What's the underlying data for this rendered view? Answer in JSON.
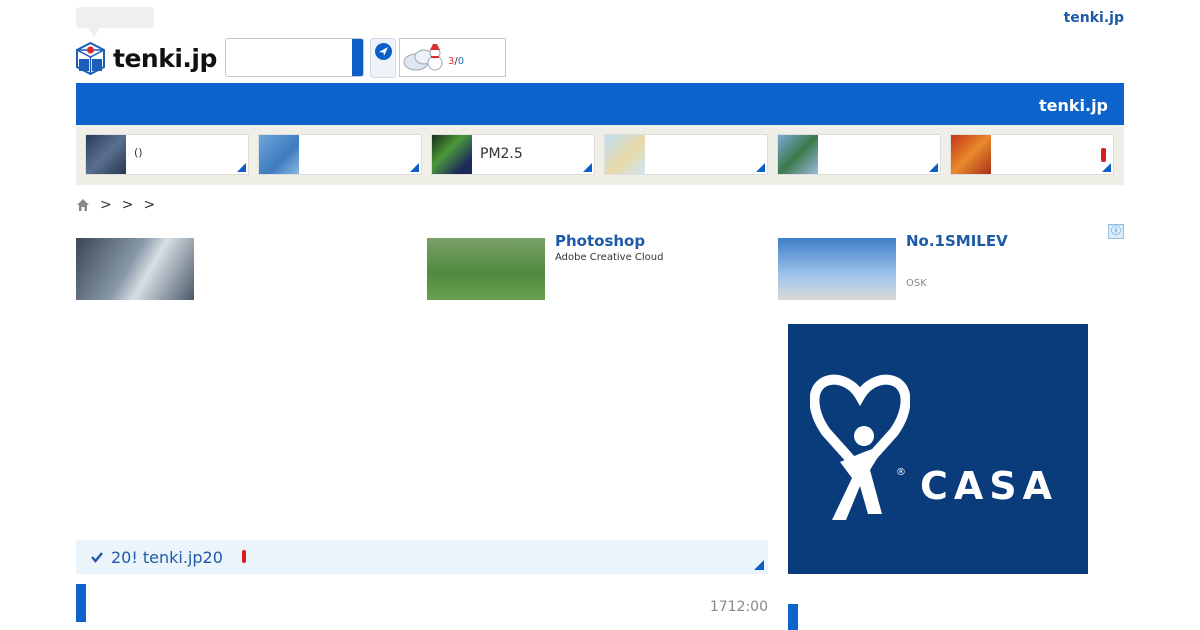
{
  "header": {
    "top_link": "tenki.jp",
    "logo_text": "tenki.jp",
    "search": {
      "placeholder": ""
    },
    "weather_widget": {
      "temp_high": "3",
      "separator": "/",
      "temp_low": "0"
    }
  },
  "banner": {
    "text": "tenki.jp"
  },
  "map_cards": [
    {
      "label": "()"
    },
    {
      "label": ""
    },
    {
      "label": "PM2.5"
    },
    {
      "label": ""
    },
    {
      "label": ""
    },
    {
      "label": ""
    }
  ],
  "breadcrumb": {
    "items": [
      ">",
      ">",
      ">"
    ]
  },
  "ads": [
    {
      "title": "",
      "sub": ""
    },
    {
      "title": "Photoshop",
      "sub": "Adobe Creative Cloud"
    },
    {
      "title": "No.1SMILEV",
      "sub": "OSK"
    }
  ],
  "ad_info": "ⓘ",
  "casa": {
    "text": "CASA"
  },
  "notice": {
    "text": "20! tenki.jp20"
  },
  "time": "1712:00",
  "colors": {
    "brand_blue": "#0c63cc",
    "link_blue": "#1d5aa8",
    "casa_navy": "#0a3b7b"
  }
}
